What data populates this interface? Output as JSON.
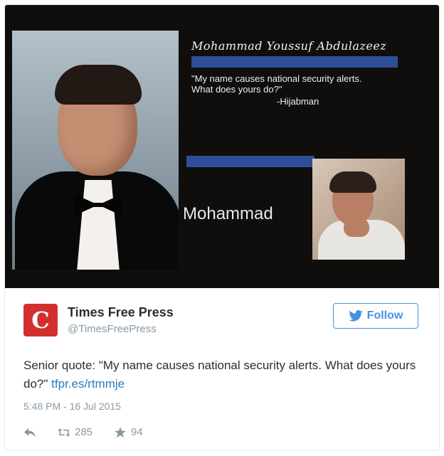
{
  "image": {
    "yearbook_name": "Mohammad Youssuf Abdulazeez",
    "quote": "\"My name causes national security alerts. What does yours do?\"",
    "attribution": "-Hijabman",
    "first_name": "Mohammad"
  },
  "tweet": {
    "author_name": "Times Free Press",
    "author_handle": "@TimesFreePress",
    "avatar_letter": "C",
    "follow_label": "Follow",
    "body_text": "Senior quote: \"My name causes national security alerts. What does yours do?\"",
    "link_text": "tfpr.es/rtmmje",
    "timestamp": "5:48 PM - 16 Jul 2015",
    "retweet_count": "285",
    "like_count": "94"
  },
  "colors": {
    "avatar_red": "#d32f2f",
    "follow_blue": "#4a90e2",
    "link_blue": "#2b7bb9",
    "muted_gray": "#8899a6",
    "yearbook_bar_blue": "#2e4f97"
  },
  "icons": [
    "twitter-bird-icon",
    "reply-icon",
    "retweet-icon",
    "favorite-star-icon"
  ]
}
